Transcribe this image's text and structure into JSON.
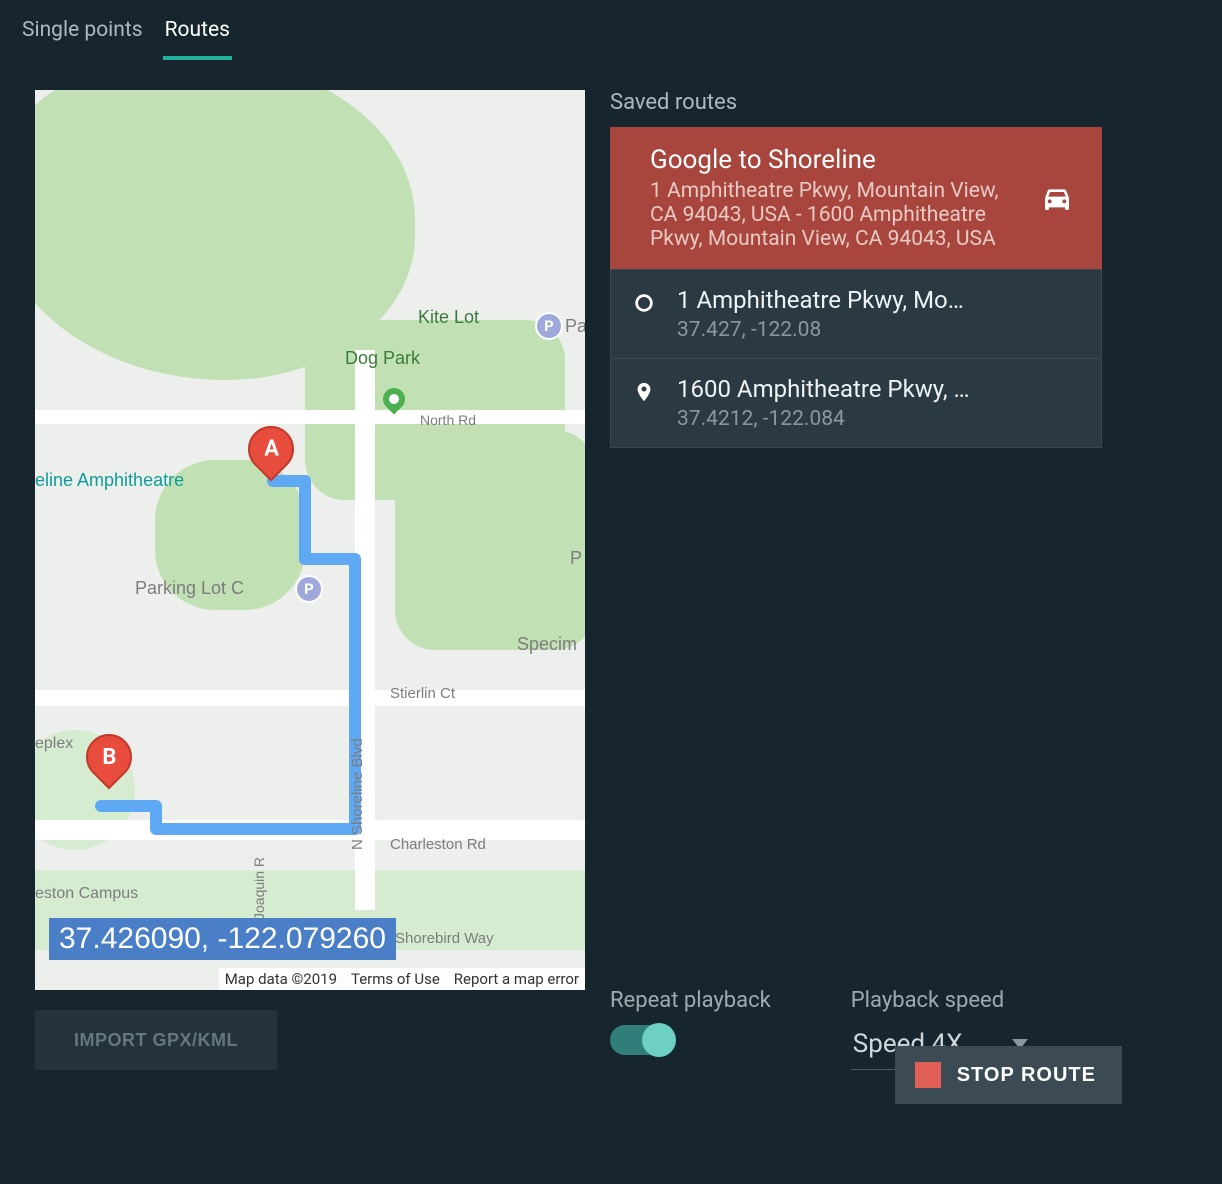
{
  "tabs": {
    "single_points": "Single points",
    "routes": "Routes"
  },
  "saved_routes_heading": "Saved routes",
  "selected_route": {
    "title": "Google to Shoreline",
    "subtitle": "1 Amphitheatre Pkwy, Mountain View, CA 94043, USA - 1600 Amphitheatre Pkwy, Mountain View, CA 94043, USA"
  },
  "waypoints": [
    {
      "title": "1 Amphitheatre Pkwy, Mo…",
      "coords": "37.427, -122.08"
    },
    {
      "title": "1600 Amphitheatre Pkwy, …",
      "coords": "37.4212, -122.084"
    }
  ],
  "controls": {
    "repeat_label": "Repeat playback",
    "speed_label": "Playback speed",
    "speed_value": "Speed 4X"
  },
  "buttons": {
    "import": "IMPORT GPX/KML",
    "stop": "STOP ROUTE"
  },
  "map": {
    "coord_badge": "37.426090, -122.079260",
    "labels": {
      "kite_lot": "Kite Lot",
      "dog_park": "Dog Park",
      "amphitheatre": "eline Amphitheatre",
      "parking_lot_c": "Parking Lot C",
      "specimen": "Specim",
      "stierlin": "Stierlin Ct",
      "n_shoreline": "N Shoreline Blvd",
      "charleston": "Charleston Rd",
      "shorebird": "Shorebird Way",
      "north_rd": "North Rd",
      "eston": "eston Campus",
      "plex": "eplex",
      "joaquin": "Joaquin R",
      "pa": "Pa",
      "p_edge": "P"
    },
    "markers": {
      "a": "A",
      "b": "B"
    },
    "attribution": {
      "data": "Map data ©2019",
      "terms": "Terms of Use",
      "report": "Report a map error"
    }
  }
}
